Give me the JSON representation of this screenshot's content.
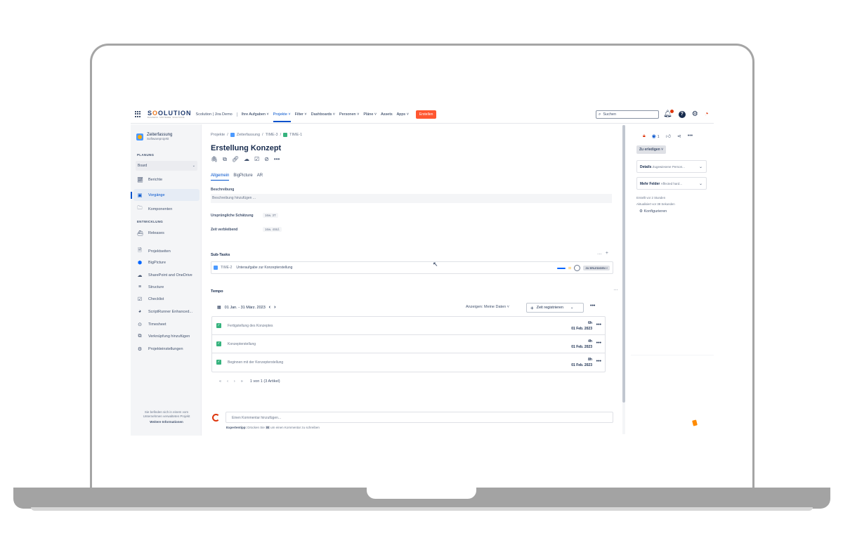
{
  "topnav": {
    "brand_part1": "S",
    "brand_highlight": "O",
    "brand_part2": "OLUTION",
    "brand_tagline": "BUSINESS. SOFTWARE. SOLUTIONS.",
    "site_name": "Scolution | Jira Demo",
    "items": [
      {
        "label": "Ihre Aufgaben ˅"
      },
      {
        "label": "Projekte ˅"
      },
      {
        "label": "Filter ˅"
      },
      {
        "label": "Dashboards ˅"
      },
      {
        "label": "Personen ˅"
      },
      {
        "label": "Pläne ˅"
      },
      {
        "label": "Assets"
      },
      {
        "label": "Apps ˅"
      }
    ],
    "create_label": "Erstellen",
    "search_placeholder": "Suchen"
  },
  "sidebar": {
    "project_name": "Zeiterfassung",
    "project_type": "Softwareprojekt",
    "planning_heading": "PLANUNG",
    "board_select": "Board",
    "development_heading": "ENTWICKLUNG",
    "items": [
      {
        "label": "Berichte",
        "icon": "chart-icon"
      },
      {
        "label": "Vorgänge",
        "icon": "issues-icon"
      },
      {
        "label": "Komponenten",
        "icon": "components-icon"
      },
      {
        "label": "Releases",
        "icon": "ship-icon"
      },
      {
        "label": "Projektseiten",
        "icon": "page-icon"
      },
      {
        "label": "BigPicture",
        "icon": "bigpicture-icon"
      },
      {
        "label": "SharePoint and OneDrive",
        "icon": "cloud-icon"
      },
      {
        "label": "Structure",
        "icon": "structure-icon"
      },
      {
        "label": "Checklist",
        "icon": "checklist-icon"
      },
      {
        "label": "ScriptRunner Enhanced...",
        "icon": "scriptrunner-icon"
      },
      {
        "label": "Timesheet",
        "icon": "clock-icon"
      },
      {
        "label": "Verknüpfung hinzufügen",
        "icon": "add-link-icon"
      },
      {
        "label": "Projekteinstellungen",
        "icon": "gear-icon"
      }
    ],
    "footer_line1": "Sie befinden sich in einem vom",
    "footer_line2": "Unternehmen verwalteten Projekt",
    "footer_more": "Weitere Informationen"
  },
  "issue": {
    "breadcrumb": [
      "Projekte",
      "Zeiterfassung",
      "TIME-3",
      "TIME-1"
    ],
    "title": "Erstellung Konzept",
    "tabs": [
      "Allgemein",
      "BigPicture",
      "AR"
    ],
    "description_label": "Beschreibung",
    "description_placeholder": "Beschreibung hinzufügen ...",
    "estimate_label": "Ursprüngliche Schätzung",
    "estimate_value": "16w. 3T",
    "remaining_label": "Zeit verbleibend",
    "remaining_value": "16w. 4Std.",
    "subtasks_label": "Sub-Tasks",
    "subtask": {
      "key": "TIME-2",
      "summary": "Unteraufgabe zur Konzepterstellung",
      "status": "ZU ERLEDIGEN ˅"
    },
    "tempo_label": "Tempo",
    "date_range": "01 Jan. - 31 März. 2023",
    "show_label": "Anzeigen: Meine Daten  ˅",
    "log_time_label": "Zeit registrieren",
    "worklogs": [
      {
        "description": "Fertigstellung des Konzeptes",
        "hours": "6h",
        "date": "01 Feb. 2023"
      },
      {
        "description": "Konzepterstellung",
        "hours": "4h",
        "date": "01 Feb. 2023"
      },
      {
        "description": "Beginnen mit der Konzepterstellung",
        "hours": "8h",
        "date": "01 Feb. 2023"
      }
    ],
    "pager_info": "1 von 1 (3 Artikel)",
    "comment_placeholder": "Einen Kommentar hinzufügen...",
    "tip_bold": "Expertentipp:",
    "tip_pre": "Drücken Sie",
    "tip_key": "M",
    "tip_post": "um einen Kommentar zu schreiben"
  },
  "rightpanel": {
    "watchers": "1",
    "status_label": "Zu erledigen  ˅",
    "details_label": "Details",
    "details_hint": "Zugewiesene Person...",
    "more_fields_label": "Mehr Felder",
    "more_fields_hint": "Affected hard...",
    "created": "Erstellt vor 2 Stunden",
    "updated": "Aktualisiert vor 38 Sekunden",
    "configure": "Konfigurieren"
  },
  "colors": {
    "accent": "#0052cc",
    "create": "#ff5630",
    "done_check": "#36b37e"
  }
}
